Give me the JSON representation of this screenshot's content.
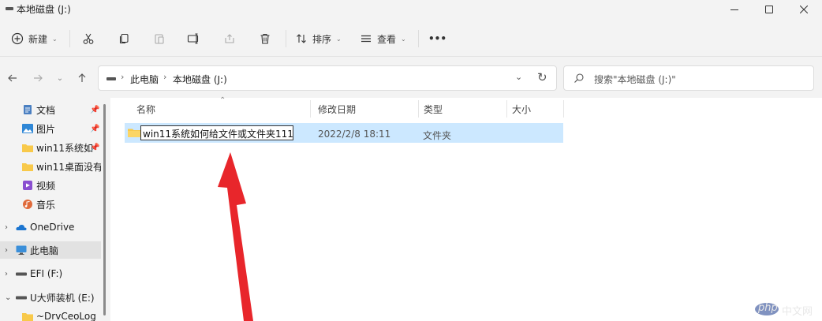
{
  "window": {
    "title": "本地磁盘 (J:)"
  },
  "toolbar": {
    "new_label": "新建",
    "sort_label": "排序",
    "view_label": "查看",
    "more_label": "•••"
  },
  "address": {
    "crumbs": [
      "此电脑",
      "本地磁盘 (J:)"
    ]
  },
  "search": {
    "placeholder": "搜索\"本地磁盘 (J:)\""
  },
  "sidebar": {
    "items": [
      {
        "label": "文档",
        "icon": "document-icon",
        "pinned": true
      },
      {
        "label": "图片",
        "icon": "picture-icon",
        "pinned": true
      },
      {
        "label": "win11系统如",
        "icon": "folder-icon",
        "pinned": true
      },
      {
        "label": "win11桌面没有",
        "icon": "folder-icon",
        "pinned": false
      },
      {
        "label": "视频",
        "icon": "video-icon",
        "pinned": false
      },
      {
        "label": "音乐",
        "icon": "music-icon",
        "pinned": false
      },
      {
        "label": "OneDrive",
        "icon": "onedrive-icon",
        "expandable": true
      },
      {
        "label": "此电脑",
        "icon": "computer-icon",
        "expandable": true,
        "selected": true
      },
      {
        "label": "EFI (F:)",
        "icon": "drive-icon",
        "expandable": true
      },
      {
        "label": "U大师装机 (E:)",
        "icon": "drive-icon",
        "expanded": true
      },
      {
        "label": "~DrvCeoLog",
        "icon": "folder-icon"
      }
    ]
  },
  "columns": {
    "name": "名称",
    "modified": "修改日期",
    "type": "类型",
    "size": "大小"
  },
  "files": [
    {
      "name": "win11系统如何给文件或文件夹111",
      "modified": "2022/2/8 18:11",
      "type": "文件夹",
      "size": ""
    }
  ],
  "watermark": {
    "php": "php",
    "site": "中文网"
  },
  "colors": {
    "selection": "#cce8ff",
    "folder": "#f8c94a",
    "arrow": "#e8262b",
    "accent": "#0067c0"
  }
}
